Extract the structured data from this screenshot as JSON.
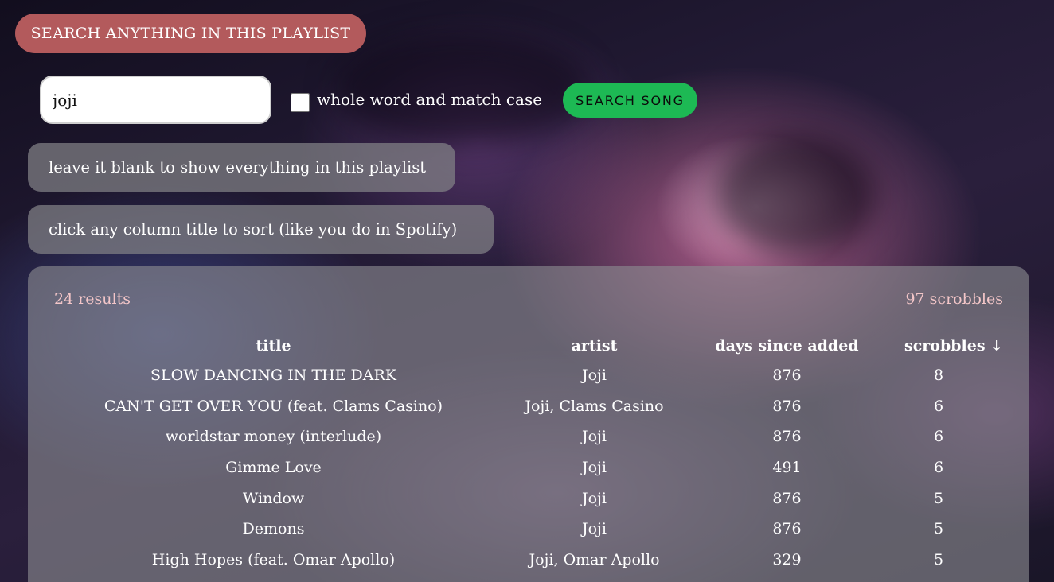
{
  "header": {
    "title": "SEARCH ANYTHING IN THIS PLAYLIST"
  },
  "search": {
    "value": "joji",
    "whole_word_label": "whole word and match case",
    "whole_word_checked": false,
    "button_label": "SEARCH SONG"
  },
  "hints": {
    "blank": "leave it blank to show everything in this playlist",
    "sort": "click any column title to sort (like you do in Spotify)"
  },
  "results": {
    "count": "24 results",
    "scrobbles_total": "97 scrobbles",
    "columns": {
      "title": "title",
      "artist": "artist",
      "days": "days since added",
      "scrobbles": "scrobbles ↓"
    },
    "rows": [
      {
        "title": "SLOW DANCING IN THE DARK",
        "artist": "Joji",
        "days": "876",
        "scrobbles": "8"
      },
      {
        "title": "CAN'T GET OVER YOU (feat. Clams Casino)",
        "artist": "Joji, Clams Casino",
        "days": "876",
        "scrobbles": "6"
      },
      {
        "title": "worldstar money (interlude)",
        "artist": "Joji",
        "days": "876",
        "scrobbles": "6"
      },
      {
        "title": "Gimme Love",
        "artist": "Joji",
        "days": "491",
        "scrobbles": "6"
      },
      {
        "title": "Window",
        "artist": "Joji",
        "days": "876",
        "scrobbles": "5"
      },
      {
        "title": "Demons",
        "artist": "Joji",
        "days": "876",
        "scrobbles": "5"
      },
      {
        "title": "High Hopes (feat. Omar Apollo)",
        "artist": "Joji, Omar Apollo",
        "days": "329",
        "scrobbles": "5"
      }
    ]
  },
  "colors": {
    "header_pill": "#b35a5c",
    "search_button": "#1db954",
    "results_meta": "#f3c6c8"
  }
}
